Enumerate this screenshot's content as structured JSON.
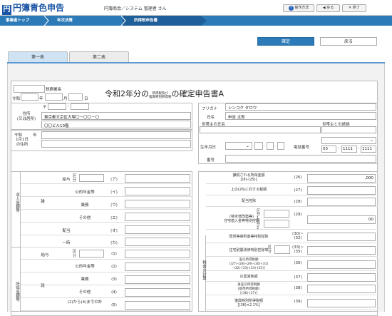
{
  "header": {
    "app_title": "円簿青色申告",
    "logo_glyph": "円",
    "user_text": "円簿商会／システム 管理者 さん",
    "help_label": "操作方法",
    "back_label": "戻る",
    "close_label": "終了"
  },
  "nav": {
    "items": [
      {
        "label": "事業者トップ"
      },
      {
        "label": "年次決算"
      },
      {
        "label": "所得税申告書"
      }
    ]
  },
  "actions": {
    "confirm": "確定",
    "back": "戻る"
  },
  "tabs": [
    {
      "label": "第一表"
    },
    {
      "label": "第二表"
    }
  ],
  "form": {
    "office_label": "税務署長",
    "date_era": "令和",
    "date_year": "年",
    "date_month": "月",
    "date_day": "日",
    "title_pre": "令和2年分の",
    "title_small1": "所得税及び",
    "title_small2": "復興特別所得税",
    "title_post": "の確定申告書A",
    "zip_mark": "〒",
    "address_label_1": "住所",
    "address_label_2": "(又は居所)",
    "address_value_1": "東京都文京区大塚〇－〇〇－〇",
    "address_value_2": "〇〇ビル10階",
    "reiwa_label": "令和",
    "reiwa_year": "年",
    "jan1_label_1": "1月1日",
    "jan1_label_2": "の住所",
    "furigana_label": "フリガナ",
    "furigana_value": "シンコク タロウ",
    "name_label": "氏名",
    "name_value": "申告 太郎",
    "head_label": "世帯主の氏名",
    "relation_label": "世帯主との続柄",
    "birth_label": "生年月日",
    "phone_label": "電話番号",
    "phone_1": "03",
    "phone_2": "1111",
    "phone_3": "1111",
    "mynumber_label": "番号"
  },
  "left_table": {
    "group1": "収入金額等",
    "group2": "所得金額等",
    "kubun": "区分",
    "rows1": [
      {
        "main": "給与",
        "sub": "",
        "code": "(ア)",
        "has_kubun": true
      },
      {
        "main": "雑",
        "sub": "公的年金等",
        "code": "(イ)"
      },
      {
        "main": "",
        "sub": "業務",
        "code": "(ウ)"
      },
      {
        "main": "",
        "sub": "その他",
        "code": "(エ)"
      },
      {
        "main": "配当",
        "sub": "",
        "code": "(オ)"
      },
      {
        "main": "一時",
        "sub": "",
        "code": "(カ)"
      }
    ],
    "rows2": [
      {
        "main": "給与",
        "code": "(1)",
        "has_kubun": true
      },
      {
        "main": "雑",
        "sub": "公的年金等",
        "code": "(2)"
      },
      {
        "main": "",
        "sub": "業務",
        "code": "(3)"
      },
      {
        "main": "",
        "sub": "その他",
        "code": "(4)"
      },
      {
        "main": "",
        "sub": "(2)から(4)までの計",
        "code": "(5)"
      }
    ]
  },
  "right_table": {
    "group": "税金の計算",
    "rows": [
      {
        "label": "課税される所得金額\n[(8)-(25)]",
        "code": "(26)",
        "value": ",000"
      },
      {
        "label": "上の(26)に対する税額",
        "code": "(27)",
        "value": ""
      },
      {
        "label": "配当控除",
        "code": "(28)",
        "value": ""
      },
      {
        "label": "(特定増改築等)\n住宅借入金等特別控除",
        "code": "(29)",
        "value": "00",
        "k1": "区分1",
        "k2": "区分2"
      },
      {
        "label": "政党等寄附金等特別控除",
        "code": "(30)~\n(32)",
        "value": ""
      },
      {
        "label": "住宅耐震改修特別控除等",
        "code": "(33)~\n(35)",
        "value": "",
        "kubun": true
      },
      {
        "label": "差引所得税額\n[(27)-(28)-(29)-(30)-(31)\n-(32)-(33)-(34)-(35)]",
        "code": "(36)",
        "value": ""
      },
      {
        "label": "災害減免額",
        "code": "(37)",
        "value": ""
      },
      {
        "label": "再差引所得税額\n(基準所得税額)\n[(36)-(37)]",
        "code": "(38)",
        "value": ""
      },
      {
        "label": "復興特別所得税額\n[(38)×2.1%]",
        "code": "(39)",
        "value": ""
      }
    ]
  }
}
